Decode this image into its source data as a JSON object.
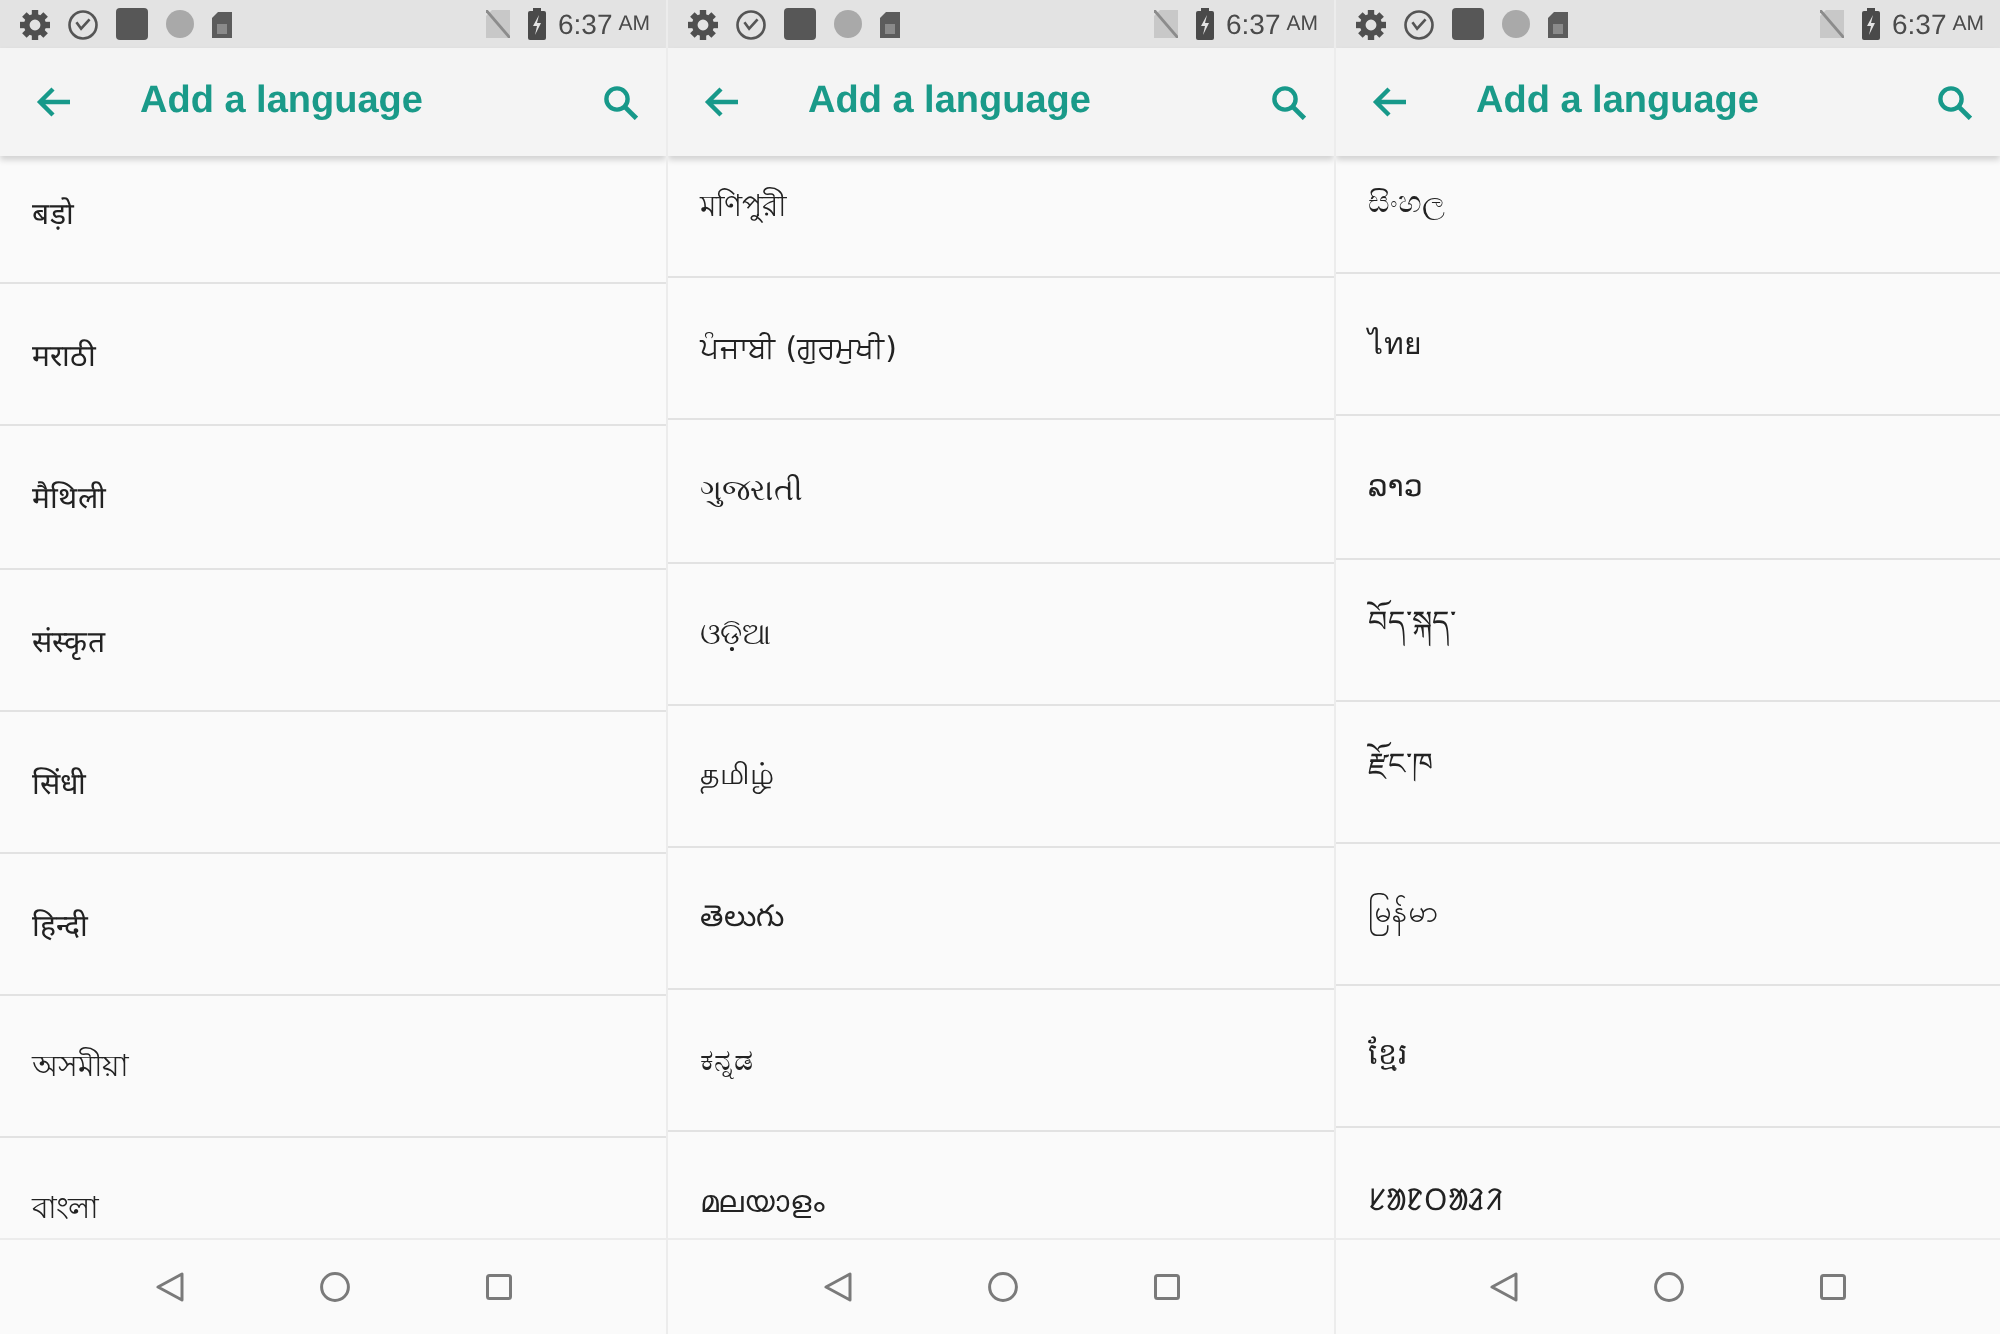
{
  "screens": [
    {
      "status_bar": {
        "time": "6:37",
        "meridiem": "AM"
      },
      "app_bar": {
        "title": "Add a language"
      },
      "languages": [
        "बड़ो",
        "मराठी",
        "मैथिली",
        "संस्कृत",
        "सिंधी",
        "हिन्दी",
        "অসমীয়া",
        "বাংলা"
      ]
    },
    {
      "status_bar": {
        "time": "6:37",
        "meridiem": "AM"
      },
      "app_bar": {
        "title": "Add a language"
      },
      "languages": [
        "মণিপুরী",
        "ਪੰਜਾਬੀ (ਗੁਰਮੁਖੀ)",
        "ગુજરાતી",
        "ଓଡ଼ିଆ",
        "தமிழ்",
        "తెలుగు",
        "ಕನ್ನಡ",
        "മലയാളം"
      ]
    },
    {
      "status_bar": {
        "time": "6:37",
        "meridiem": "AM"
      },
      "app_bar": {
        "title": "Add a language"
      },
      "languages": [
        "සිංහල",
        "ไทย",
        "ລາວ",
        "བོད་སྐད་",
        "རྫོང་ཁ",
        "မြန်မာ",
        "ខ្មែរ",
        "ᱥᱟᱱᱛᱟᱲᱤ"
      ]
    }
  ]
}
